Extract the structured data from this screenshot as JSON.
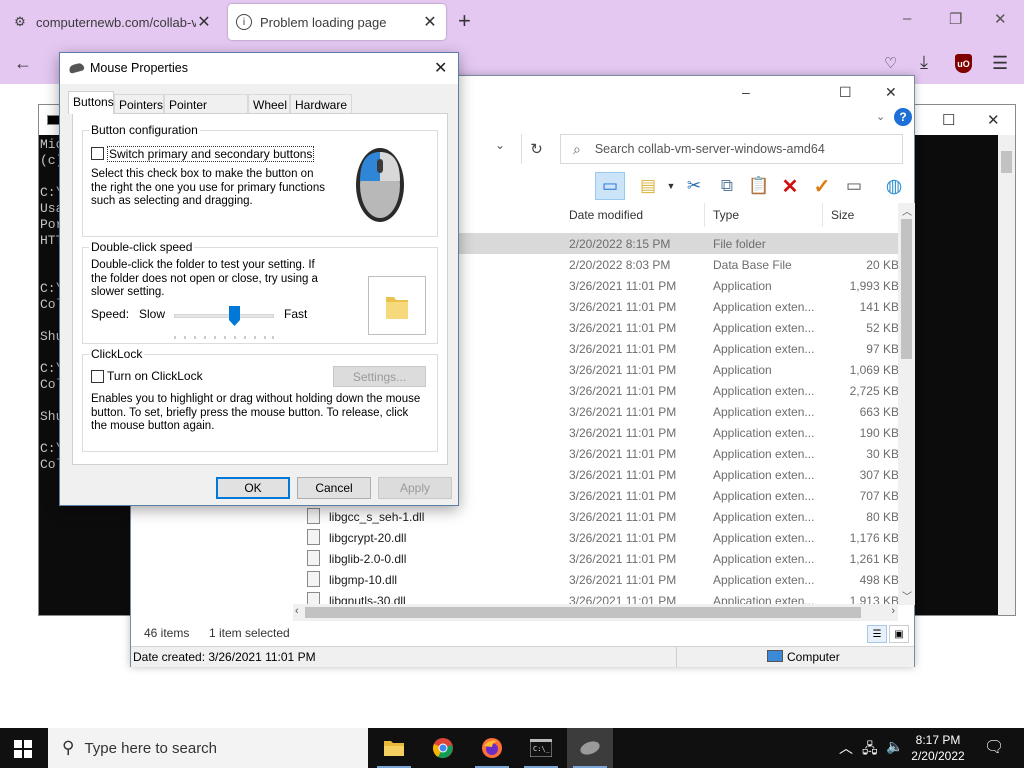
{
  "browser": {
    "tabs": [
      {
        "title": "computernewb.com/collab-vm",
        "active": false
      },
      {
        "title": "Problem loading page",
        "active": true
      }
    ],
    "new_tab": "+",
    "window_controls": [
      "–",
      "❐",
      "✕"
    ]
  },
  "console": {
    "lines": [
      "Mic",
      "(c)",
      "",
      "C:\\",
      "Usa",
      "Por",
      "HTT",
      "",
      "C:\\",
      "Col",
      "",
      "Shu",
      "",
      "C:\\",
      "Col",
      "",
      "Shu",
      "",
      "C:\\",
      "Col"
    ]
  },
  "explorer": {
    "search_placeholder": "Search collab-vm-server-windows-amd64",
    "columns": {
      "date": "Date modified",
      "type": "Type",
      "size": "Size"
    },
    "rows": [
      {
        "name": "",
        "date": "2/20/2022 8:15 PM",
        "type": "File folder",
        "size": "",
        "selected": true
      },
      {
        "name": "",
        "date": "2/20/2022 8:03 PM",
        "type": "Data Base File",
        "size": "20 KB"
      },
      {
        "name": "",
        "date": "3/26/2021 11:01 PM",
        "type": "Application",
        "size": "1,993 KB"
      },
      {
        "name": "",
        "date": "3/26/2021 11:01 PM",
        "type": "Application exten...",
        "size": "141 KB"
      },
      {
        "name": "",
        "date": "3/26/2021 11:01 PM",
        "type": "Application exten...",
        "size": "52 KB"
      },
      {
        "name": "",
        "date": "3/26/2021 11:01 PM",
        "type": "Application exten...",
        "size": "97 KB"
      },
      {
        "name": "",
        "date": "3/26/2021 11:01 PM",
        "type": "Application",
        "size": "1,069 KB"
      },
      {
        "name": "",
        "date": "3/26/2021 11:01 PM",
        "type": "Application exten...",
        "size": "2,725 KB"
      },
      {
        "name": "",
        "date": "3/26/2021 11:01 PM",
        "type": "Application exten...",
        "size": "663 KB"
      },
      {
        "name": "",
        "date": "3/26/2021 11:01 PM",
        "type": "Application exten...",
        "size": "190 KB"
      },
      {
        "name": "",
        "date": "3/26/2021 11:01 PM",
        "type": "Application exten...",
        "size": "30 KB"
      },
      {
        "name": "",
        "date": "3/26/2021 11:01 PM",
        "type": "Application exten...",
        "size": "307 KB"
      },
      {
        "name": "",
        "date": "3/26/2021 11:01 PM",
        "type": "Application exten...",
        "size": "707 KB"
      },
      {
        "name": "libgcc_s_seh-1.dll",
        "date": "3/26/2021 11:01 PM",
        "type": "Application exten...",
        "size": "80 KB"
      },
      {
        "name": "libgcrypt-20.dll",
        "date": "3/26/2021 11:01 PM",
        "type": "Application exten...",
        "size": "1,176 KB"
      },
      {
        "name": "libglib-2.0-0.dll",
        "date": "3/26/2021 11:01 PM",
        "type": "Application exten...",
        "size": "1,261 KB"
      },
      {
        "name": "libgmp-10.dll",
        "date": "3/26/2021 11:01 PM",
        "type": "Application exten...",
        "size": "498 KB"
      },
      {
        "name": "libgnutls-30.dll",
        "date": "3/26/2021 11:01 PM",
        "type": "Application exten...",
        "size": "1,913 KB"
      }
    ],
    "item_count": "46 items",
    "selection": "1 item selected",
    "date_created": "Date created: 3/26/2021 11:01 PM",
    "location": "Computer"
  },
  "dialog": {
    "title": "Mouse Properties",
    "tabs": [
      "Buttons",
      "Pointers",
      "Pointer Options",
      "Wheel",
      "Hardware"
    ],
    "button_config": {
      "legend": "Button configuration",
      "checkbox_label": "Switch primary and secondary buttons",
      "checked": false,
      "description": "Select this check box to make the button on the right the one you use for primary functions such as selecting and dragging."
    },
    "double_click": {
      "legend": "Double-click speed",
      "description": "Double-click the folder to test your setting. If the folder does not open or close, try using a slower setting.",
      "speed_label": "Speed:",
      "slow": "Slow",
      "fast": "Fast",
      "speed_level": 0.6
    },
    "clicklock": {
      "legend": "ClickLock",
      "checkbox_label": "Turn on ClickLock",
      "checked": false,
      "settings_button": "Settings...",
      "description": "Enables you to highlight or drag without holding down the mouse button. To set, briefly press the mouse button. To release, click the mouse button again."
    },
    "buttons": {
      "ok": "OK",
      "cancel": "Cancel",
      "apply": "Apply"
    }
  },
  "taskbar": {
    "search_placeholder": "Type here to search",
    "time": "8:17 PM",
    "date": "2/20/2022"
  }
}
